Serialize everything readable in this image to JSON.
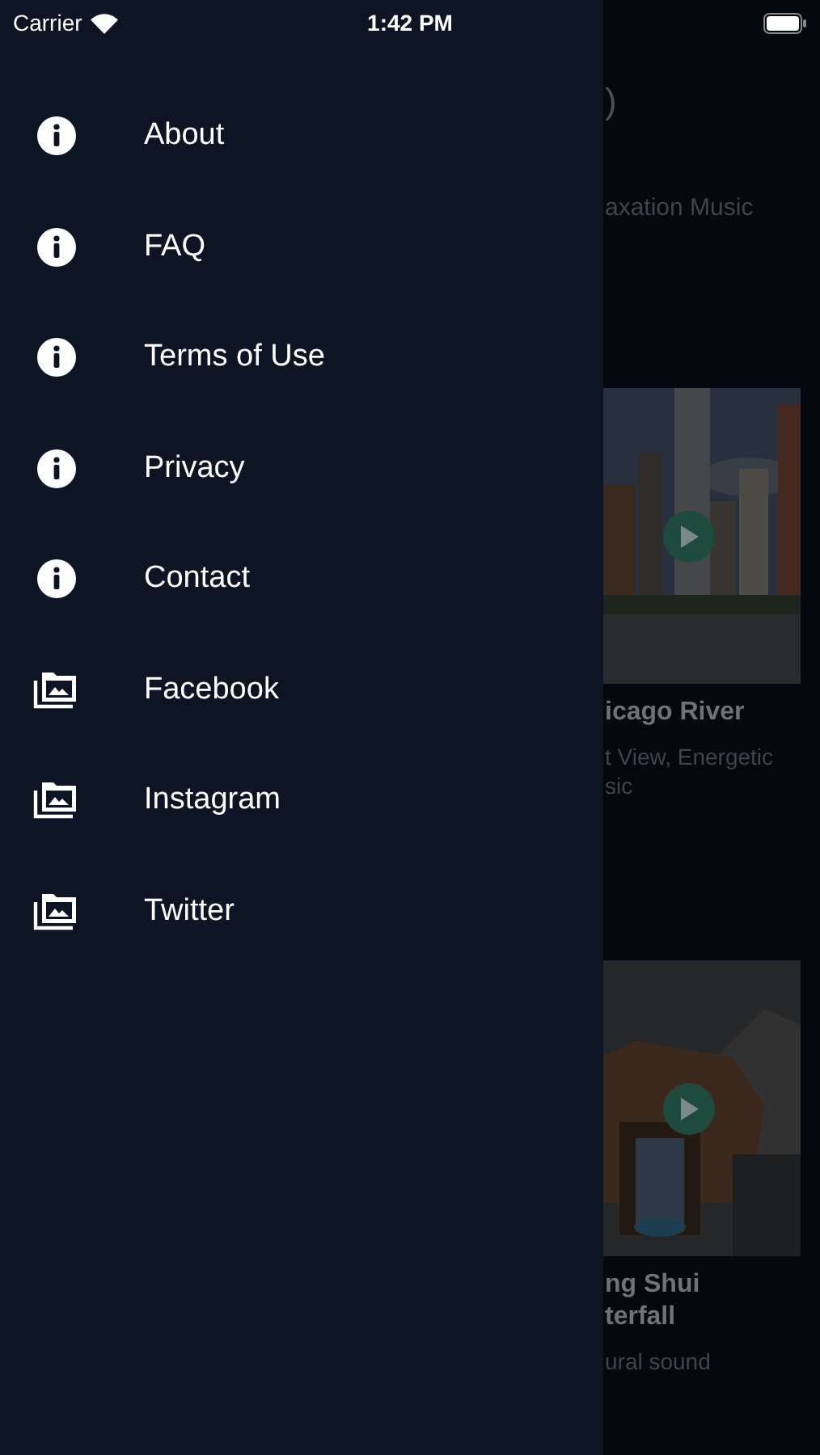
{
  "status_bar": {
    "carrier": "Carrier",
    "time": "1:42 PM"
  },
  "menu": [
    {
      "label": "About",
      "kind": "info"
    },
    {
      "label": "FAQ",
      "kind": "info"
    },
    {
      "label": "Terms of Use",
      "kind": "info"
    },
    {
      "label": "Privacy",
      "kind": "info"
    },
    {
      "label": "Contact",
      "kind": "info"
    },
    {
      "label": "Facebook",
      "kind": "gallery"
    },
    {
      "label": "Instagram",
      "kind": "gallery"
    },
    {
      "label": "Twitter",
      "kind": "gallery"
    }
  ],
  "background": {
    "heading": ")",
    "subtitle": "axation Music",
    "cards": [
      {
        "kind": "city",
        "title_lines": [
          "icago River"
        ],
        "subtitle_lines": [
          "t View, Energetic",
          "sic"
        ]
      },
      {
        "kind": "waterfall",
        "title_lines": [
          "ng Shui",
          "terfall"
        ],
        "subtitle_lines": [
          "ural sound"
        ]
      }
    ]
  }
}
